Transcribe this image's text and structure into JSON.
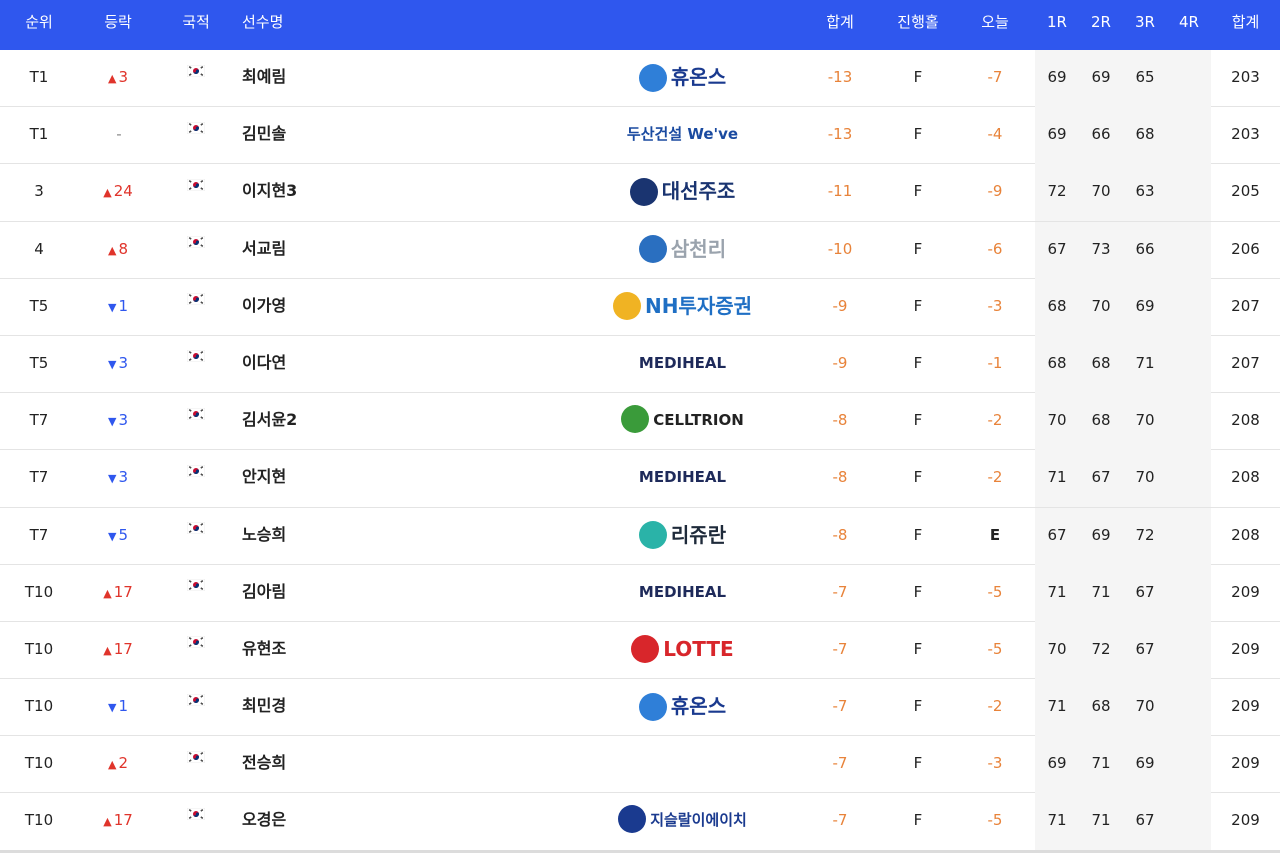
{
  "header": {
    "rank": "순위",
    "move": "등락",
    "nation": "국적",
    "player": "선수명",
    "total": "합계",
    "holes": "진행홀",
    "today": "오늘",
    "r1": "1R",
    "r2": "2R",
    "r3": "3R",
    "r4": "4R",
    "sum": "합계"
  },
  "colors": {
    "header_bg": "#2f57ee",
    "up": "#e0342b",
    "down": "#2f57ee",
    "score": "#e8833a"
  },
  "rows": [
    {
      "rank": "T1",
      "dir": "up",
      "move": "3",
      "name": "최예림",
      "sponsor": "휴온스",
      "sponsor_color": "#1a3a8f",
      "sponsor_icon": "hu-circle-icon",
      "total": "-13",
      "holes": "F",
      "today": "-7",
      "r1": "69",
      "r2": "69",
      "r3": "65",
      "r4": "",
      "sum": "203"
    },
    {
      "rank": "T1",
      "dir": "none",
      "move": "-",
      "name": "김민솔",
      "sponsor": "두산건설 We've",
      "sponsor_color": "#1a4aa0",
      "sponsor_icon": "",
      "total": "-13",
      "holes": "F",
      "today": "-4",
      "r1": "69",
      "r2": "66",
      "r3": "68",
      "r4": "",
      "sum": "203"
    },
    {
      "rank": "3",
      "dir": "up",
      "move": "24",
      "name": "이지현3",
      "sponsor": "대선주조",
      "sponsor_color": "#1a3470",
      "sponsor_icon": "daesun-badge-icon",
      "total": "-11",
      "holes": "F",
      "today": "-9",
      "r1": "72",
      "r2": "70",
      "r3": "63",
      "r4": "",
      "sum": "205"
    },
    {
      "rank": "4",
      "dir": "up",
      "move": "8",
      "name": "서교림",
      "sponsor": "삼천리",
      "sponsor_color": "#9aa3ad",
      "sponsor_icon": "samchully-globe-icon",
      "total": "-10",
      "holes": "F",
      "today": "-6",
      "r1": "67",
      "r2": "73",
      "r3": "66",
      "r4": "",
      "sum": "206"
    },
    {
      "rank": "T5",
      "dir": "down",
      "move": "1",
      "name": "이가영",
      "sponsor": "NH투자증권",
      "sponsor_color": "#1f6fc4",
      "sponsor_icon": "nh-icon",
      "total": "-9",
      "holes": "F",
      "today": "-3",
      "r1": "68",
      "r2": "70",
      "r3": "69",
      "r4": "",
      "sum": "207"
    },
    {
      "rank": "T5",
      "dir": "down",
      "move": "3",
      "name": "이다연",
      "sponsor": "MEDIHEAL",
      "sponsor_color": "#1e2a5a",
      "sponsor_icon": "",
      "total": "-9",
      "holes": "F",
      "today": "-1",
      "r1": "68",
      "r2": "68",
      "r3": "71",
      "r4": "",
      "sum": "207"
    },
    {
      "rank": "T7",
      "dir": "down",
      "move": "3",
      "name": "김서윤2",
      "sponsor": "CELLTRION",
      "sponsor_color": "#222222",
      "sponsor_icon": "celltrion-dots-icon",
      "total": "-8",
      "holes": "F",
      "today": "-2",
      "r1": "70",
      "r2": "68",
      "r3": "70",
      "r4": "",
      "sum": "208"
    },
    {
      "rank": "T7",
      "dir": "down",
      "move": "3",
      "name": "안지현",
      "sponsor": "MEDIHEAL",
      "sponsor_color": "#1e2a5a",
      "sponsor_icon": "",
      "total": "-8",
      "holes": "F",
      "today": "-2",
      "r1": "71",
      "r2": "67",
      "r3": "70",
      "r4": "",
      "sum": "208"
    },
    {
      "rank": "T7",
      "dir": "down",
      "move": "5",
      "name": "노승희",
      "sponsor": "리쥬란",
      "sponsor_color": "#1e2a3a",
      "sponsor_icon": "rejuran-icon",
      "total": "-8",
      "holes": "F",
      "today": "E",
      "r1": "67",
      "r2": "69",
      "r3": "72",
      "r4": "",
      "sum": "208"
    },
    {
      "rank": "T10",
      "dir": "up",
      "move": "17",
      "name": "김아림",
      "sponsor": "MEDIHEAL",
      "sponsor_color": "#1e2a5a",
      "sponsor_icon": "",
      "total": "-7",
      "holes": "F",
      "today": "-5",
      "r1": "71",
      "r2": "71",
      "r3": "67",
      "r4": "",
      "sum": "209"
    },
    {
      "rank": "T10",
      "dir": "up",
      "move": "17",
      "name": "유현조",
      "sponsor": "LOTTE",
      "sponsor_color": "#d8262b",
      "sponsor_icon": "lotte-circle-icon",
      "total": "-7",
      "holes": "F",
      "today": "-5",
      "r1": "70",
      "r2": "72",
      "r3": "67",
      "r4": "",
      "sum": "209"
    },
    {
      "rank": "T10",
      "dir": "down",
      "move": "1",
      "name": "최민경",
      "sponsor": "휴온스",
      "sponsor_color": "#1a3a8f",
      "sponsor_icon": "hu-circle-icon",
      "total": "-7",
      "holes": "F",
      "today": "-2",
      "r1": "71",
      "r2": "68",
      "r3": "70",
      "r4": "",
      "sum": "209"
    },
    {
      "rank": "T10",
      "dir": "up",
      "move": "2",
      "name": "전승희",
      "sponsor": "",
      "sponsor_color": "#222222",
      "sponsor_icon": "",
      "total": "-7",
      "holes": "F",
      "today": "-3",
      "r1": "69",
      "r2": "71",
      "r3": "69",
      "r4": "",
      "sum": "209"
    },
    {
      "rank": "T10",
      "dir": "up",
      "move": "17",
      "name": "오경은",
      "sponsor": "지슬랄이에이치",
      "sponsor_color": "#1a3a8f",
      "sponsor_icon": "jisol-logo-icon",
      "total": "-7",
      "holes": "F",
      "today": "-5",
      "r1": "71",
      "r2": "71",
      "r3": "67",
      "r4": "",
      "sum": "209"
    }
  ]
}
